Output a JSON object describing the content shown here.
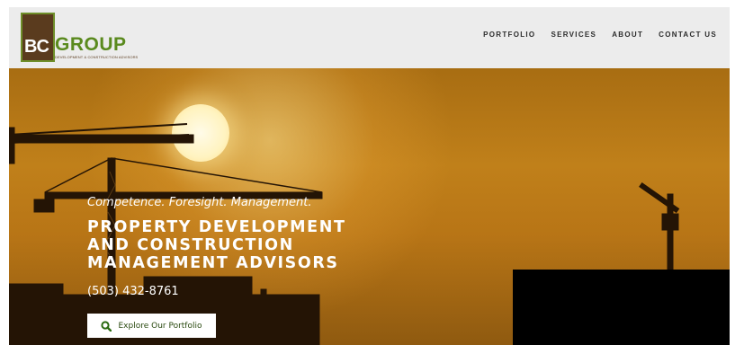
{
  "brand": {
    "logo_mark": "BC",
    "logo_name": "GROUP",
    "logo_tagline": "DEVELOPMENT & CONSTRUCTION ADVISORS"
  },
  "nav": {
    "items": [
      {
        "label": "PORTFOLIO"
      },
      {
        "label": "SERVICES"
      },
      {
        "label": "ABOUT"
      },
      {
        "label": "CONTACT US"
      }
    ]
  },
  "hero": {
    "tagline": "Competence. Foresight. Management.",
    "headline_lines": [
      "PROPERTY DEVELOPMENT",
      "AND CONSTRUCTION",
      "MANAGEMENT ADVISORS"
    ],
    "phone": "(503) 432-8761",
    "cta": {
      "label": "Explore Our Portfolio",
      "icon": "search-icon"
    }
  },
  "colors": {
    "brand_brown": "#5a3b1e",
    "brand_green": "#5a8a1e",
    "hero_orange": "#c0801a",
    "cta_icon": "#2a6a10"
  }
}
